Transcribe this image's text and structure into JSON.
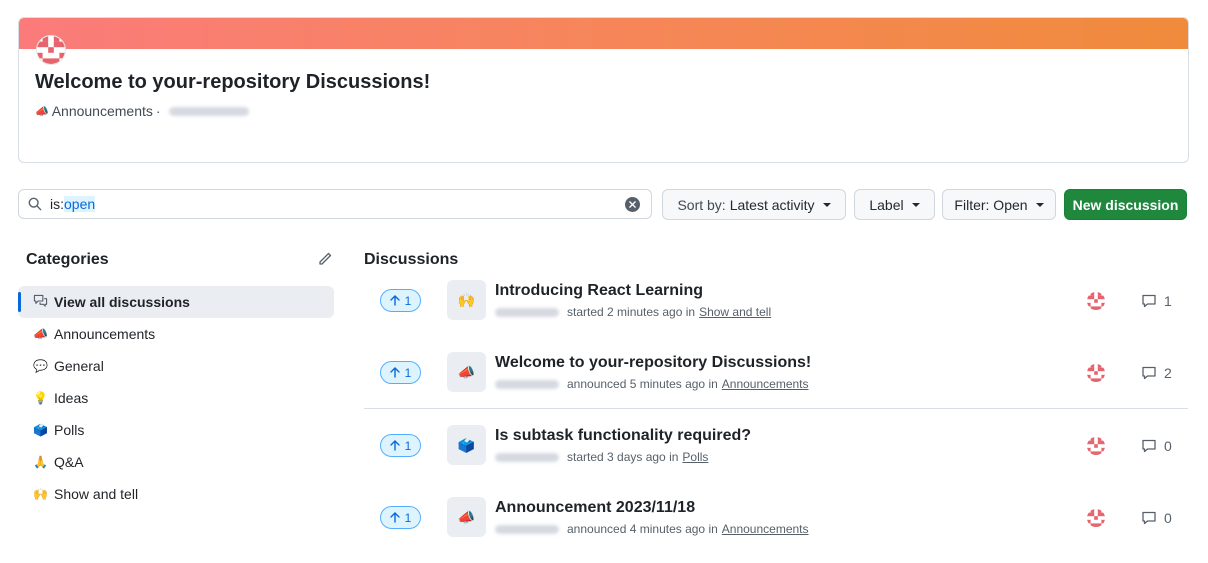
{
  "banner": {
    "title": "Welcome to your-repository Discussions!",
    "category_emoji": "📣",
    "category": "Announcements",
    "separator": "·"
  },
  "search": {
    "prefix": "is:",
    "value": "open"
  },
  "toolbar": {
    "sort_prefix": "Sort by:",
    "sort_value": "Latest activity",
    "label_button": "Label",
    "filter_button": "Filter: Open",
    "new_discussion": "New discussion"
  },
  "sidebar": {
    "title": "Categories",
    "items": [
      {
        "label": "View all discussions",
        "icon": "comment-discussion-icon",
        "active": true
      },
      {
        "label": "Announcements",
        "emoji": "📣"
      },
      {
        "label": "General",
        "emoji": "💬"
      },
      {
        "label": "Ideas",
        "emoji": "💡"
      },
      {
        "label": "Polls",
        "emoji": "🗳️"
      },
      {
        "label": "Q&A",
        "emoji": "🙏"
      },
      {
        "label": "Show and tell",
        "emoji": "🙌"
      }
    ]
  },
  "discussions": {
    "title": "Discussions",
    "rows": [
      {
        "upvotes": "1",
        "emoji": "🙌",
        "title": "Introducing React Learning",
        "action": "started 2 minutes ago in",
        "category": "Show and tell",
        "comments": "1"
      },
      {
        "upvotes": "1",
        "emoji": "📣",
        "title": "Welcome to your-repository Discussions!",
        "action": "announced 5 minutes ago in",
        "category": "Announcements",
        "comments": "2"
      },
      {
        "upvotes": "1",
        "emoji": "🗳️",
        "title": "Is subtask functionality required?",
        "action": "started 3 days ago in",
        "category": "Polls",
        "comments": "0"
      },
      {
        "upvotes": "1",
        "emoji": "📣",
        "title": "Announcement 2023/11/18",
        "action": "announced 4 minutes ago in",
        "category": "Announcements",
        "comments": "0"
      }
    ]
  },
  "colors": {
    "primary_button": "#1f883d",
    "accent": "#0969da",
    "avatar": "#e5646d"
  }
}
